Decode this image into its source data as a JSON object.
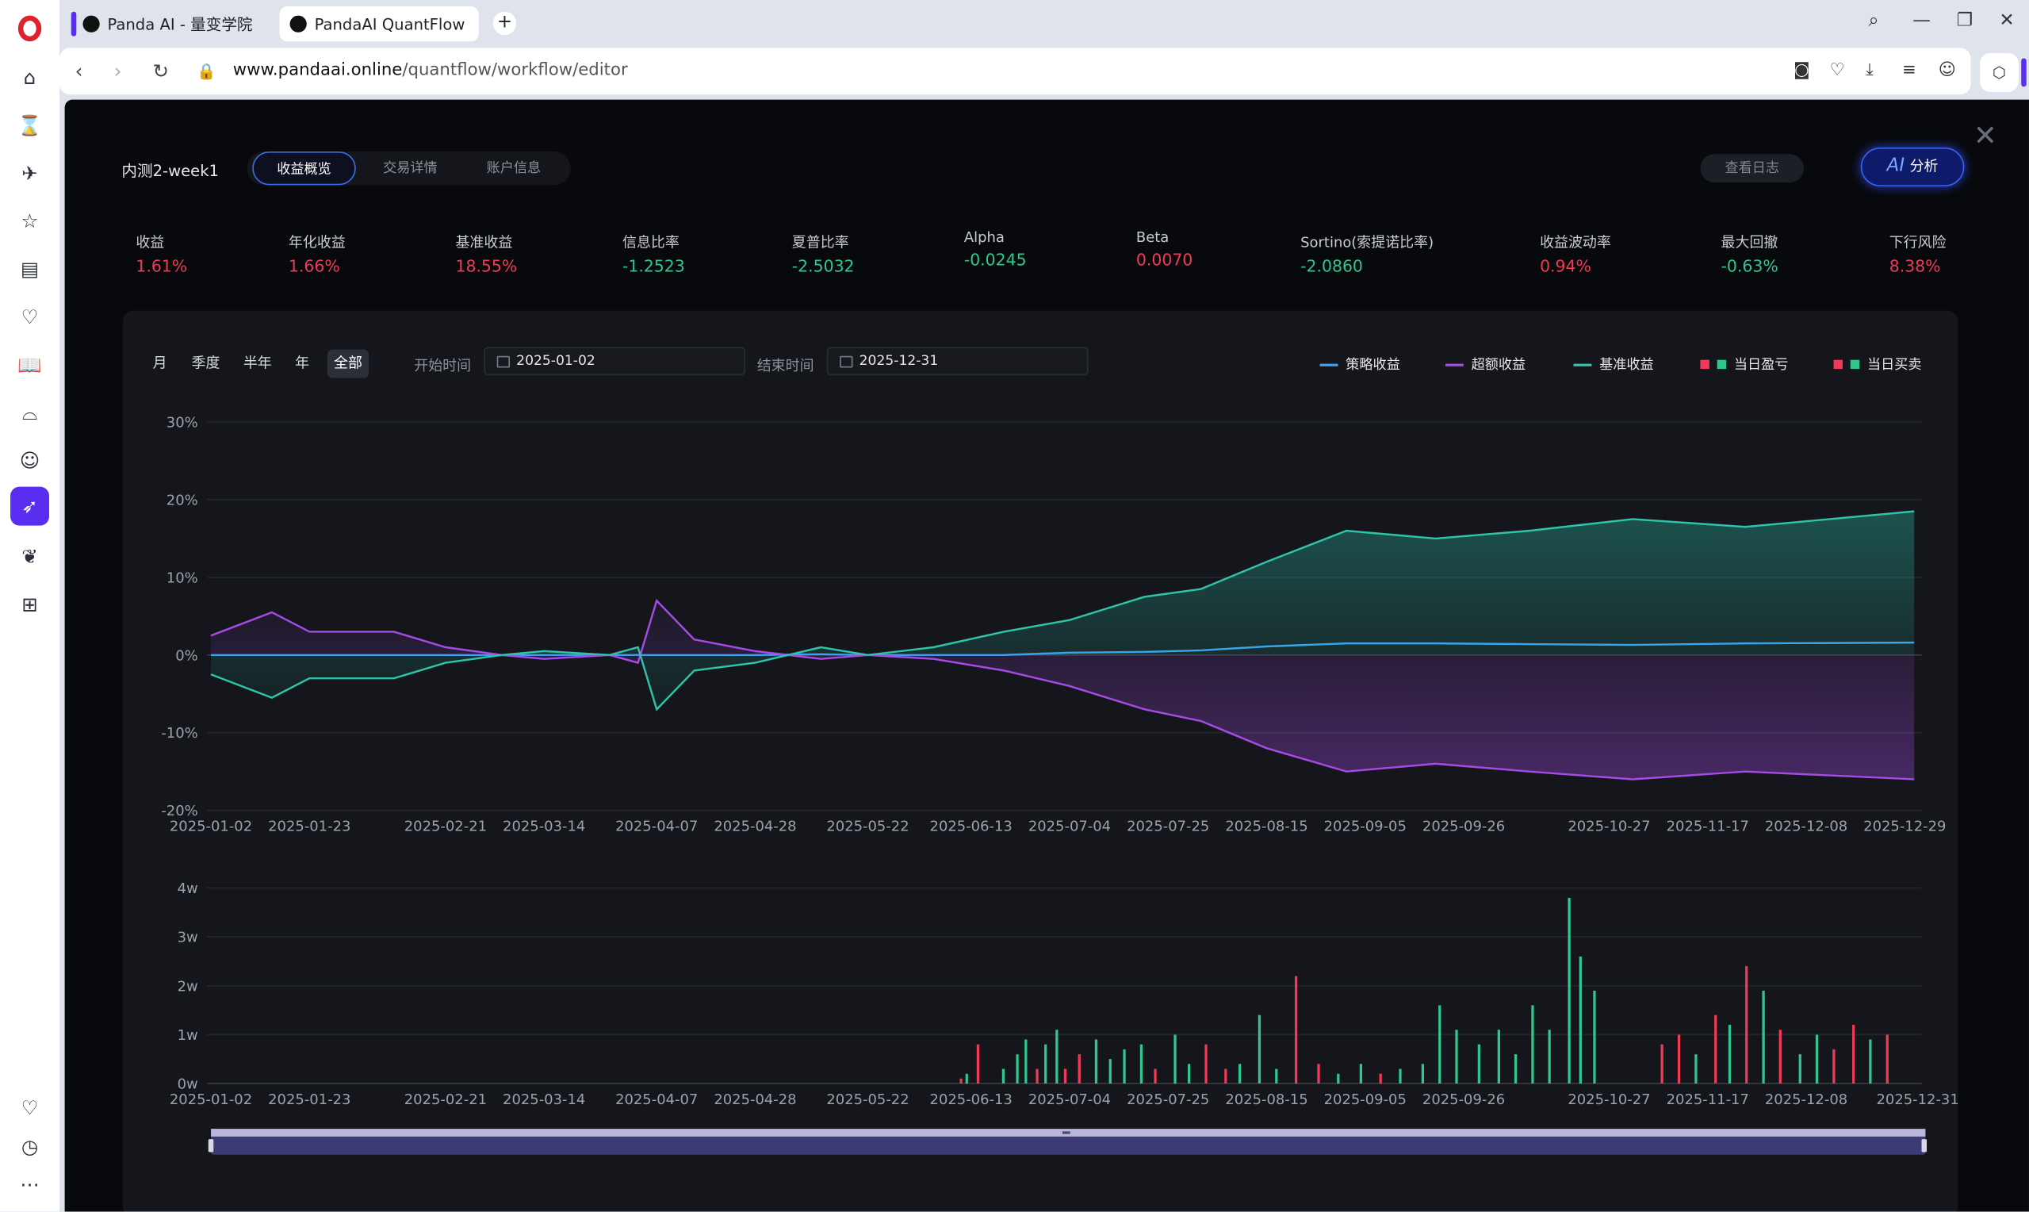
{
  "browser": {
    "tabs": [
      {
        "title": "Panda AI - 量变学院"
      },
      {
        "title": "PandaAI QuantFlow"
      }
    ],
    "url_domain": "www.pandaai.online",
    "url_path": "/quantflow/workflow/editor"
  },
  "page": {
    "title": "内测2-week1",
    "tabs": [
      {
        "label": "收益概览",
        "active": true
      },
      {
        "label": "交易详情",
        "active": false
      },
      {
        "label": "账户信息",
        "active": false
      }
    ],
    "log_button": "查看日志",
    "ai_button": {
      "prefix": "AI",
      "label": "分析"
    }
  },
  "metrics": [
    {
      "label": "收益",
      "value": "1.61%",
      "tone": "pos"
    },
    {
      "label": "年化收益",
      "value": "1.66%",
      "tone": "pos"
    },
    {
      "label": "基准收益",
      "value": "18.55%",
      "tone": "pos"
    },
    {
      "label": "信息比率",
      "value": "-1.2523",
      "tone": "neg"
    },
    {
      "label": "夏普比率",
      "value": "-2.5032",
      "tone": "neg"
    },
    {
      "label": "Alpha",
      "value": "-0.0245",
      "tone": "neg"
    },
    {
      "label": "Beta",
      "value": "0.0070",
      "tone": "pos"
    },
    {
      "label": "Sortino(索提诺比率)",
      "value": "-2.0860",
      "tone": "neg"
    },
    {
      "label": "收益波动率",
      "value": "0.94%",
      "tone": "pos"
    },
    {
      "label": "最大回撤",
      "value": "-0.63%",
      "tone": "neg"
    },
    {
      "label": "下行风险",
      "value": "8.38%",
      "tone": "pos"
    }
  ],
  "filters": {
    "periods": [
      {
        "label": "月",
        "active": false
      },
      {
        "label": "季度",
        "active": false
      },
      {
        "label": "半年",
        "active": false
      },
      {
        "label": "年",
        "active": false
      },
      {
        "label": "全部",
        "active": true
      }
    ],
    "start_label": "开始时间",
    "start_value": "2025-01-02",
    "end_label": "结束时间",
    "end_value": "2025-12-31"
  },
  "legend": [
    {
      "label": "策略收益",
      "color": "#3aa0f5"
    },
    {
      "label": "超额收益",
      "color": "#a64ae6"
    },
    {
      "label": "基准收益",
      "color": "#2ec4a9"
    },
    {
      "label": "当日盈亏",
      "colors": [
        "#f03a57",
        "#2ec78e"
      ]
    },
    {
      "label": "当日买卖",
      "colors": [
        "#f03a57",
        "#2ec78e"
      ]
    }
  ],
  "chart_data": [
    {
      "type": "line",
      "y_ticks": [
        "30%",
        "20%",
        "10%",
        "0%",
        "-10%",
        "-20%"
      ],
      "x_ticks": [
        "2025-01-02",
        "2025-01-23",
        "2025-02-21",
        "2025-03-14",
        "2025-04-07",
        "2025-04-28",
        "2025-05-22",
        "2025-06-13",
        "2025-07-04",
        "2025-07-25",
        "2025-08-15",
        "2025-09-05",
        "2025-09-26",
        "2025-10-27",
        "2025-11-17",
        "2025-12-08",
        "2025-12-29"
      ],
      "ylim": [
        -20,
        30
      ],
      "series": [
        {
          "name": "策略收益",
          "color": "#3aa0f5",
          "values": [
            0,
            0,
            0,
            0,
            0,
            0,
            0,
            0,
            0,
            0,
            0,
            0,
            0.1,
            0,
            0,
            0,
            0.3,
            0.4,
            0.6,
            1.1,
            1.5,
            1.5,
            1.4,
            1.3,
            1.5,
            1.6
          ]
        },
        {
          "name": "超额收益",
          "color": "#a64ae6",
          "values": [
            2.5,
            5.5,
            3,
            3,
            1,
            0,
            -0.5,
            0,
            -1,
            7,
            2,
            0.5,
            -0.5,
            0,
            -0.5,
            -2,
            -4,
            -7,
            -8.5,
            -12,
            -15,
            -14,
            -15,
            -16,
            -15,
            -16
          ]
        },
        {
          "name": "基准收益",
          "color": "#2ec4a9",
          "values": [
            -2.5,
            -5.5,
            -3,
            -3,
            -1,
            0,
            0.5,
            0,
            1,
            -7,
            -2,
            -1,
            1,
            0,
            1,
            3,
            4.5,
            7.5,
            8.5,
            12,
            16,
            15,
            16,
            17.5,
            16.5,
            18.5
          ]
        }
      ],
      "series_x": [
        "2025-01-02",
        "2025-01-15",
        "2025-01-23",
        "2025-02-10",
        "2025-02-21",
        "2025-03-05",
        "2025-03-14",
        "2025-03-28",
        "2025-04-03",
        "2025-04-07",
        "2025-04-15",
        "2025-04-28",
        "2025-05-12",
        "2025-05-22",
        "2025-06-05",
        "2025-06-20",
        "2025-07-04",
        "2025-07-20",
        "2025-08-01",
        "2025-08-15",
        "2025-09-01",
        "2025-09-20",
        "2025-10-10",
        "2025-11-01",
        "2025-11-25",
        "2025-12-31"
      ]
    },
    {
      "type": "bar",
      "y_ticks": [
        "4w",
        "3w",
        "2w",
        "1w",
        "0w"
      ],
      "x_ticks": [
        "2025-01-02",
        "2025-01-23",
        "2025-02-21",
        "2025-03-14",
        "2025-04-07",
        "2025-04-28",
        "2025-05-22",
        "2025-06-13",
        "2025-07-04",
        "2025-07-25",
        "2025-08-15",
        "2025-09-05",
        "2025-09-26",
        "2025-10-27",
        "2025-11-17",
        "2025-12-08",
        "2025-12-31"
      ],
      "ylim": [
        0,
        4
      ],
      "unit": "w",
      "bars": [
        [
          0.6,
          0.1,
          "pos"
        ],
        [
          0.8,
          0.2,
          "neg"
        ],
        [
          1.2,
          0.8,
          "pos"
        ],
        [
          2.1,
          0.3,
          "neg"
        ],
        [
          2.6,
          0.6,
          "neg"
        ],
        [
          2.9,
          0.9,
          "neg"
        ],
        [
          3.3,
          0.3,
          "pos"
        ],
        [
          3.6,
          0.8,
          "neg"
        ],
        [
          4.0,
          1.1,
          "neg"
        ],
        [
          4.3,
          0.3,
          "pos"
        ],
        [
          4.8,
          0.6,
          "pos"
        ],
        [
          5.4,
          0.9,
          "neg"
        ],
        [
          5.9,
          0.5,
          "neg"
        ],
        [
          6.4,
          0.7,
          "neg"
        ],
        [
          7.0,
          0.8,
          "neg"
        ],
        [
          7.5,
          0.3,
          "pos"
        ],
        [
          8.2,
          1.0,
          "neg"
        ],
        [
          8.7,
          0.4,
          "neg"
        ],
        [
          9.3,
          0.8,
          "pos"
        ],
        [
          10.0,
          0.3,
          "pos"
        ],
        [
          10.5,
          0.4,
          "neg"
        ],
        [
          11.2,
          1.4,
          "neg"
        ],
        [
          11.8,
          0.3,
          "neg"
        ],
        [
          12.5,
          2.2,
          "pos"
        ],
        [
          13.3,
          0.4,
          "pos"
        ],
        [
          14.0,
          0.2,
          "neg"
        ],
        [
          14.8,
          0.4,
          "neg"
        ],
        [
          15.5,
          0.2,
          "pos"
        ],
        [
          16.2,
          0.3,
          "neg"
        ],
        [
          17.0,
          0.4,
          "neg"
        ],
        [
          17.6,
          1.6,
          "neg"
        ],
        [
          18.2,
          1.1,
          "neg"
        ],
        [
          19.0,
          0.8,
          "neg"
        ],
        [
          19.7,
          1.1,
          "neg"
        ],
        [
          20.3,
          0.6,
          "neg"
        ],
        [
          20.9,
          1.6,
          "neg"
        ],
        [
          21.5,
          1.1,
          "neg"
        ],
        [
          22.2,
          3.8,
          "neg"
        ],
        [
          22.6,
          2.6,
          "neg"
        ],
        [
          23.1,
          1.9,
          "neg"
        ],
        [
          25.5,
          0.8,
          "pos"
        ],
        [
          26.1,
          1.0,
          "pos"
        ],
        [
          26.7,
          0.6,
          "neg"
        ],
        [
          27.4,
          1.4,
          "pos"
        ],
        [
          27.9,
          1.2,
          "neg"
        ],
        [
          28.5,
          2.4,
          "pos"
        ],
        [
          29.1,
          1.9,
          "neg"
        ],
        [
          29.7,
          1.1,
          "pos"
        ],
        [
          30.4,
          0.6,
          "neg"
        ],
        [
          31.0,
          1.0,
          "neg"
        ],
        [
          31.6,
          0.7,
          "pos"
        ],
        [
          32.3,
          1.2,
          "pos"
        ],
        [
          32.9,
          0.9,
          "neg"
        ],
        [
          33.5,
          1.0,
          "pos"
        ]
      ]
    }
  ]
}
